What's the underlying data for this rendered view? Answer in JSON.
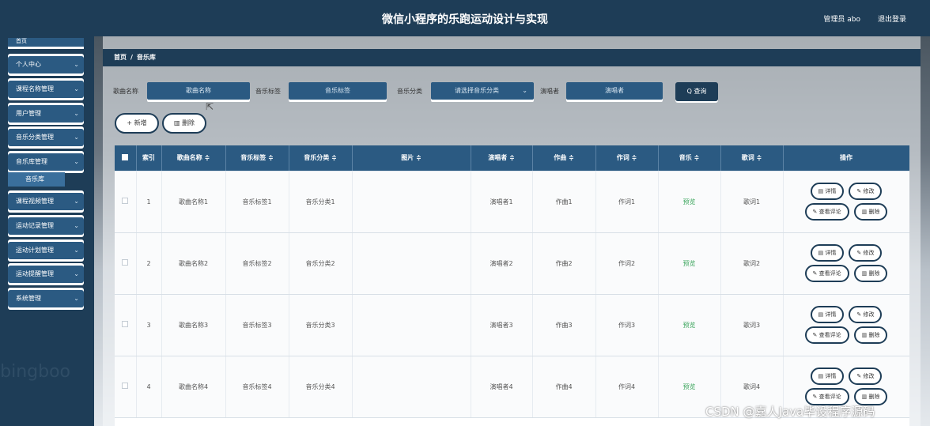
{
  "header": {
    "title": "微信小程序的乐跑运动设计与实现",
    "user": "管理员 abo",
    "logout": "退出登录"
  },
  "sidebar": {
    "home": "首页",
    "items": [
      {
        "label": "个人中心"
      },
      {
        "label": "课程名称管理"
      },
      {
        "label": "用户管理"
      },
      {
        "label": "音乐分类管理"
      },
      {
        "label": "音乐库管理"
      },
      {
        "label": "课程视频管理"
      },
      {
        "label": "运动记录管理"
      },
      {
        "label": "运动计划管理"
      },
      {
        "label": "运动提醒管理"
      },
      {
        "label": "系统管理"
      }
    ],
    "active_sub": "音乐库",
    "watermark": "jbingboo"
  },
  "breadcrumb": {
    "home": "首页",
    "sep": "/",
    "current": "音乐库"
  },
  "filters": {
    "name_label": "歌曲名称",
    "name_placeholder": "歌曲名称",
    "tag_label": "音乐标签",
    "tag_placeholder": "音乐标签",
    "category_label": "音乐分类",
    "category_placeholder": "请选择音乐分类",
    "singer_label": "演唱者",
    "singer_placeholder": "演唱者",
    "search": "Q 查询"
  },
  "actions": {
    "add": "+ 新增",
    "delete": "删除"
  },
  "table": {
    "headers": [
      "索引",
      "歌曲名称 ≑",
      "音乐标签 ≑",
      "音乐分类 ≑",
      "图片 ≑",
      "演唱者 ≑",
      "作曲 ≑",
      "作词 ≑",
      "音乐 ≑",
      "歌词 ≑",
      "操作"
    ],
    "rows": [
      {
        "index": "1",
        "name": "歌曲名称1",
        "tag": "音乐标签1",
        "category": "音乐分类1",
        "image": "",
        "singer": "演唱者1",
        "composer": "作曲1",
        "lyricist": "作词1",
        "music": "预览",
        "lyrics": "歌词1"
      },
      {
        "index": "2",
        "name": "歌曲名称2",
        "tag": "音乐标签2",
        "category": "音乐分类2",
        "image": "",
        "singer": "演唱者2",
        "composer": "作曲2",
        "lyricist": "作词2",
        "music": "预览",
        "lyrics": "歌词2"
      },
      {
        "index": "3",
        "name": "歌曲名称3",
        "tag": "音乐标签3",
        "category": "音乐分类3",
        "image": "",
        "singer": "演唱者3",
        "composer": "作曲3",
        "lyricist": "作词3",
        "music": "预览",
        "lyrics": "歌词3"
      },
      {
        "index": "4",
        "name": "歌曲名称4",
        "tag": "音乐标签4",
        "category": "音乐分类4",
        "image": "",
        "singer": "演唱者4",
        "composer": "作曲4",
        "lyricist": "作词4",
        "music": "预览",
        "lyrics": "歌词4"
      }
    ],
    "row_actions": {
      "detail": "▤ 详情",
      "edit": "✎ 修改",
      "comments": "✎ 查看评论",
      "delete": "▥ 删除"
    }
  },
  "watermark": "CSDN @嘉人Java毕设程序源码"
}
